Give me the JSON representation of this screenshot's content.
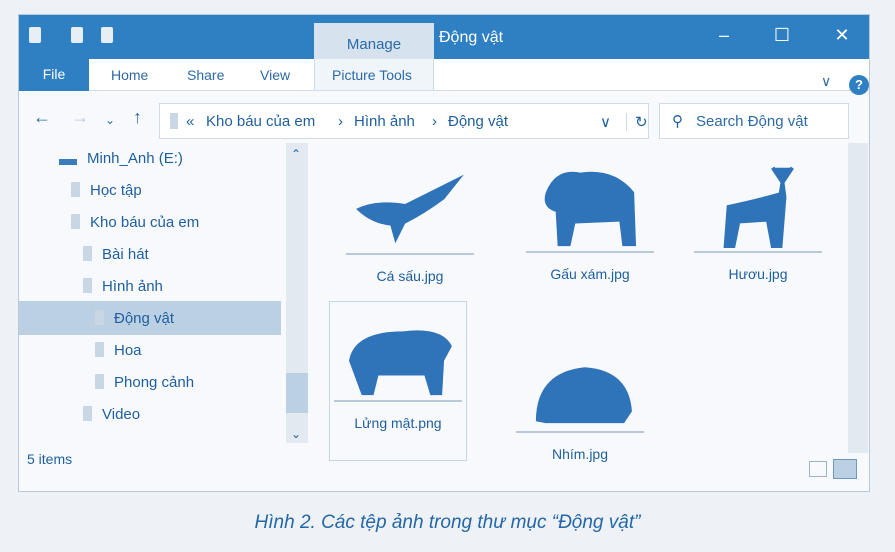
{
  "window": {
    "title": "Động vật",
    "manage_tab": "Manage",
    "min": "–",
    "max": "☐",
    "close": "✕"
  },
  "ribbon": {
    "tabs": [
      "File",
      "Home",
      "Share",
      "View",
      "Picture Tools"
    ],
    "help": "?",
    "expand": "∨"
  },
  "address": {
    "sep": "«",
    "crumbs": [
      "Kho báu của em",
      "Hình ảnh",
      "Động vật"
    ],
    "arrow": "›",
    "dropdown": "∨",
    "refresh": "↻"
  },
  "search": {
    "placeholder": "Search Động vật"
  },
  "nav": {
    "items": [
      {
        "label": "Minh_Anh (E:)",
        "indent": 0,
        "type": "drive"
      },
      {
        "label": "Học tập",
        "indent": 1
      },
      {
        "label": "Kho báu của em",
        "indent": 1
      },
      {
        "label": "Bài hát",
        "indent": 2
      },
      {
        "label": "Hình ảnh",
        "indent": 2
      },
      {
        "label": "Động vật",
        "indent": 3,
        "selected": true
      },
      {
        "label": "Hoa",
        "indent": 3
      },
      {
        "label": "Phong cảnh",
        "indent": 3
      },
      {
        "label": "Video",
        "indent": 2
      }
    ]
  },
  "files": [
    {
      "name": "Cá sấu.jpg",
      "icon": "crocodile-image"
    },
    {
      "name": "Gấu xám.jpg",
      "icon": "bear-image"
    },
    {
      "name": "Hươu.jpg",
      "icon": "deer-image"
    },
    {
      "name": "Lửng mật.png",
      "icon": "honey-badger-image"
    },
    {
      "name": "Nhím.jpg",
      "icon": "hedgehog-image"
    }
  ],
  "status": {
    "count": "5 items"
  },
  "caption": "Hình 2. Các tệp ảnh trong thư mục “Động vật”",
  "colors": {
    "accent": "#2f7fc3",
    "selection": "#bcd0e4"
  }
}
